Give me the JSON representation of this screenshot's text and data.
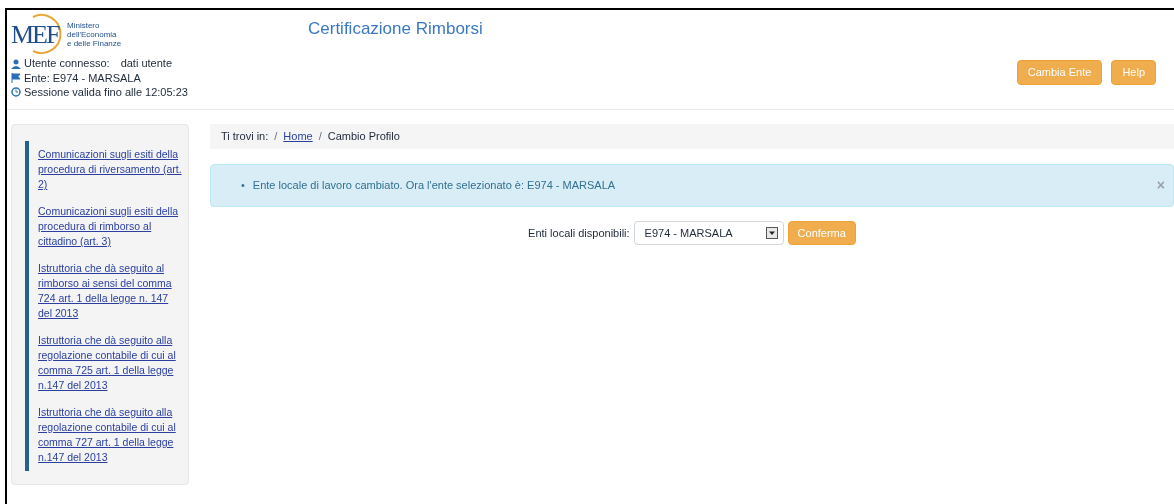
{
  "header": {
    "logo": {
      "mark": "MEF",
      "lines": [
        "Ministero",
        "dell'Economia",
        "e delle Finanze"
      ]
    },
    "title": "Certificazione Rimborsi",
    "user": {
      "label": "Utente connesso:",
      "value": "dati utente"
    },
    "ente": "Ente: E974 - MARSALA",
    "session": "Sessione valida fino alle 12:05:23",
    "buttons": [
      "Cambia Ente",
      "Help"
    ]
  },
  "sidebar": {
    "items": [
      {
        "label": "Comunicazioni sugli esiti della procedura di riversamento (art. 2)"
      },
      {
        "label": "Comunicazioni sugli esiti della procedura di rimborso al cittadino (art. 3)"
      },
      {
        "label": "Istruttoria che dà seguito al rimborso ai sensi del comma 724 art. 1 della legge n. 147 del 2013"
      },
      {
        "label": "Istruttoria che dà seguito alla regolazione contabile di cui al comma 725 art. 1 della legge n.147 del 2013"
      },
      {
        "label": "Istruttoria che dà seguito alla regolazione contabile di cui al comma 727 art. 1 della legge n.147 del 2013"
      }
    ]
  },
  "breadcrumb": {
    "prefix": "Ti trovi in:",
    "items": [
      {
        "label": "Home",
        "link": true
      },
      {
        "label": "Cambio Profilo",
        "link": false
      }
    ],
    "separator": "/"
  },
  "alert": {
    "bullet": "•",
    "message": "Ente locale di lavoro cambiato. Ora l'ente selezionato è: E974 - MARSALA",
    "close": "×"
  },
  "form": {
    "label": "Enti locali disponibili:",
    "value": "E974 - MARSALA",
    "button": "Conferma"
  }
}
